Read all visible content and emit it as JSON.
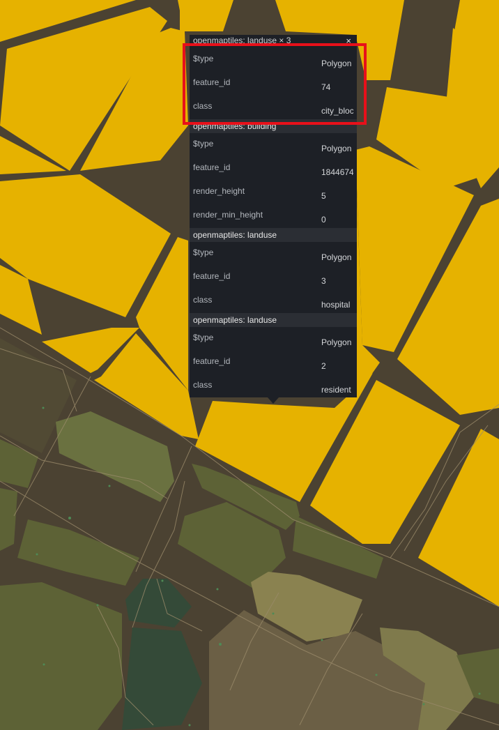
{
  "popup": {
    "close_label": "×",
    "sections": [
      {
        "title": "openmaptiles: landuse × 3",
        "rows": [
          {
            "key": "$type",
            "value": "Polygon"
          },
          {
            "key": "feature_id",
            "value": "74"
          },
          {
            "key": "class",
            "value": "city_bloc"
          }
        ]
      },
      {
        "title": "openmaptiles: building",
        "rows": [
          {
            "key": "$type",
            "value": "Polygon"
          },
          {
            "key": "feature_id",
            "value": "1844674"
          },
          {
            "key": "render_height",
            "value": "5"
          },
          {
            "key": "render_min_height",
            "value": "0"
          }
        ]
      },
      {
        "title": "openmaptiles: landuse",
        "rows": [
          {
            "key": "$type",
            "value": "Polygon"
          },
          {
            "key": "feature_id",
            "value": "3"
          },
          {
            "key": "class",
            "value": "hospital"
          }
        ]
      },
      {
        "title": "openmaptiles: landuse",
        "rows": [
          {
            "key": "$type",
            "value": "Polygon"
          },
          {
            "key": "feature_id",
            "value": "2"
          },
          {
            "key": "class",
            "value": "resident"
          }
        ]
      }
    ]
  },
  "colors": {
    "city_block": "#e6b200",
    "road": "#4b4232",
    "park": "#5d6236",
    "hospital_area": "#6b5f45",
    "green_dark": "#344a38",
    "highlight": "#e8101a"
  }
}
